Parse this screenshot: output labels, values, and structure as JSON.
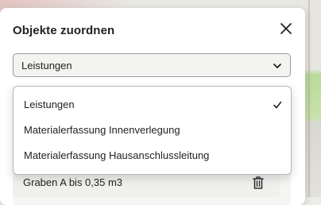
{
  "dialog": {
    "title": "Objekte zuordnen",
    "close_icon": "close-icon"
  },
  "select": {
    "value": "Leistungen",
    "chevron_icon": "chevron-down-icon"
  },
  "dropdown": {
    "options": [
      {
        "label": "Leistungen",
        "selected": true
      },
      {
        "label": "Materialerfassung Innenverlegung",
        "selected": false
      },
      {
        "label": "Materialerfassung Hausanschlussleitung",
        "selected": false
      }
    ],
    "selected_icon": "check-icon"
  },
  "list": {
    "items": [
      {
        "label": "Graben A bis 0,35 m3",
        "action_icon": "trash-icon"
      }
    ]
  }
}
